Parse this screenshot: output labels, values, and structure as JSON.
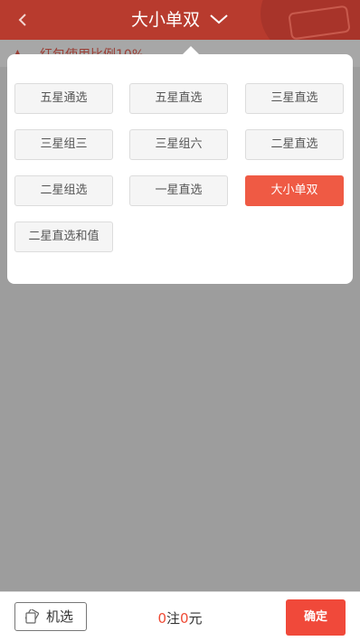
{
  "header": {
    "back_icon": "chevron-left-icon",
    "title": "大小单双",
    "dropdown_icon": "chevron-down-icon",
    "logo_icon": "lottery-logo-icon"
  },
  "bonus_bar": {
    "text": "红包使用比例10%"
  },
  "play_types": {
    "options": [
      "五星通选",
      "五星直选",
      "三星直选",
      "三星组三",
      "三星组六",
      "二星直选",
      "二星组选",
      "一星直选",
      "大小单双",
      "二星直选和值"
    ],
    "selected": "大小单双"
  },
  "footer": {
    "random_label": "机选",
    "count": "0",
    "count_unit": "注",
    "amount": "0",
    "amount_unit": "元",
    "confirm_label": "确定"
  },
  "colors": {
    "header_bg": "#b83b2e",
    "accent": "#ef5a44",
    "overlay": "#9d9d9d"
  }
}
